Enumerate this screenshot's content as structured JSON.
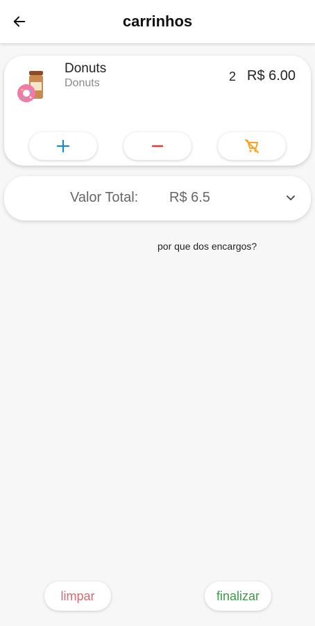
{
  "appbar": {
    "title": "carrinhos"
  },
  "cart": {
    "items": [
      {
        "name": "Donuts",
        "subtitle": "Donuts",
        "quantity": "2",
        "price": "R$ 6.00"
      }
    ],
    "actions": {
      "increase_icon": "plus-icon",
      "decrease_icon": "minus-icon",
      "remove_icon": "remove-cart-icon"
    }
  },
  "summary": {
    "total_label": "Valor Total:",
    "total_value": "R$ 6.5",
    "charges_link": "por que dos encargos?"
  },
  "footer": {
    "clear_label": "limpar",
    "finish_label": "finalizar"
  },
  "colors": {
    "plus": "#1e88c8",
    "minus": "#e53935",
    "remove": "#f5a623",
    "clear_text": "#d36b72",
    "finish_text": "#3c9a4a"
  }
}
